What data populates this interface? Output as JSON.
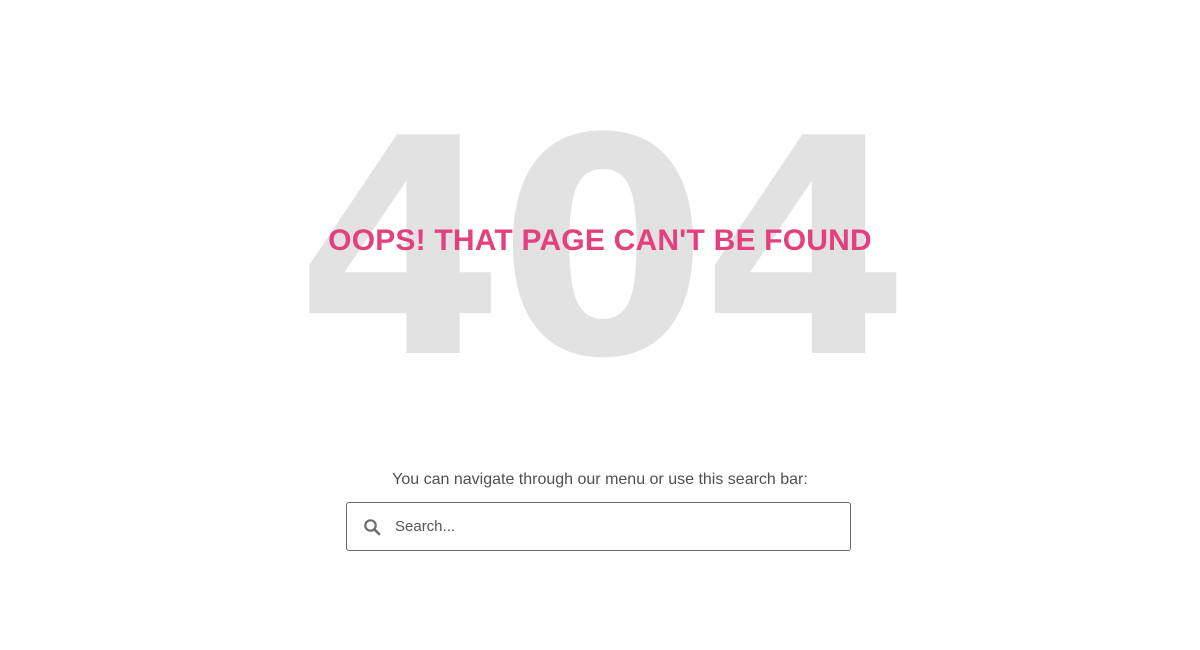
{
  "error": {
    "code": "404",
    "headline": "OOPS! THAT PAGE CAN'T BE FOUND"
  },
  "navigation_hint": "You can navigate through our menu or use this search bar:",
  "search": {
    "placeholder": "Search...",
    "value": "",
    "icon": "search-icon"
  },
  "colors": {
    "accent": "#e5407e",
    "code_background": "#e2e2e2",
    "text": "#505050",
    "border": "#6b6b6b"
  }
}
